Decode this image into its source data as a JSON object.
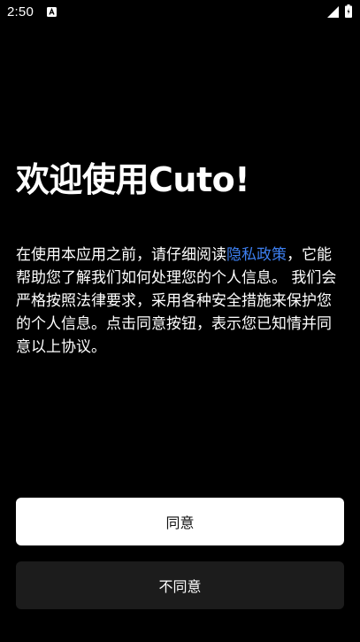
{
  "status_bar": {
    "time": "2:50",
    "notification_icon": "a-notification-icon",
    "signal_icon": "cell-signal-icon",
    "battery_icon": "battery-icon"
  },
  "dialog": {
    "title": "欢迎使用Cuto!",
    "text_before_link": "在使用本应用之前，请仔细阅读",
    "link_text": "隐私政策",
    "text_after_link": "，它能帮助您了解我们如何处理您的个人信息。 我们会严格按照法律要求，采用各种安全措施来保护您的个人信息。点击同意按钮，表示您已知情并同意以上协议。",
    "agree_label": "同意",
    "disagree_label": "不同意"
  },
  "colors": {
    "background": "#000000",
    "link": "#3d7ff0",
    "agree_button": "#ffffff",
    "disagree_button": "#1c1c1c"
  }
}
